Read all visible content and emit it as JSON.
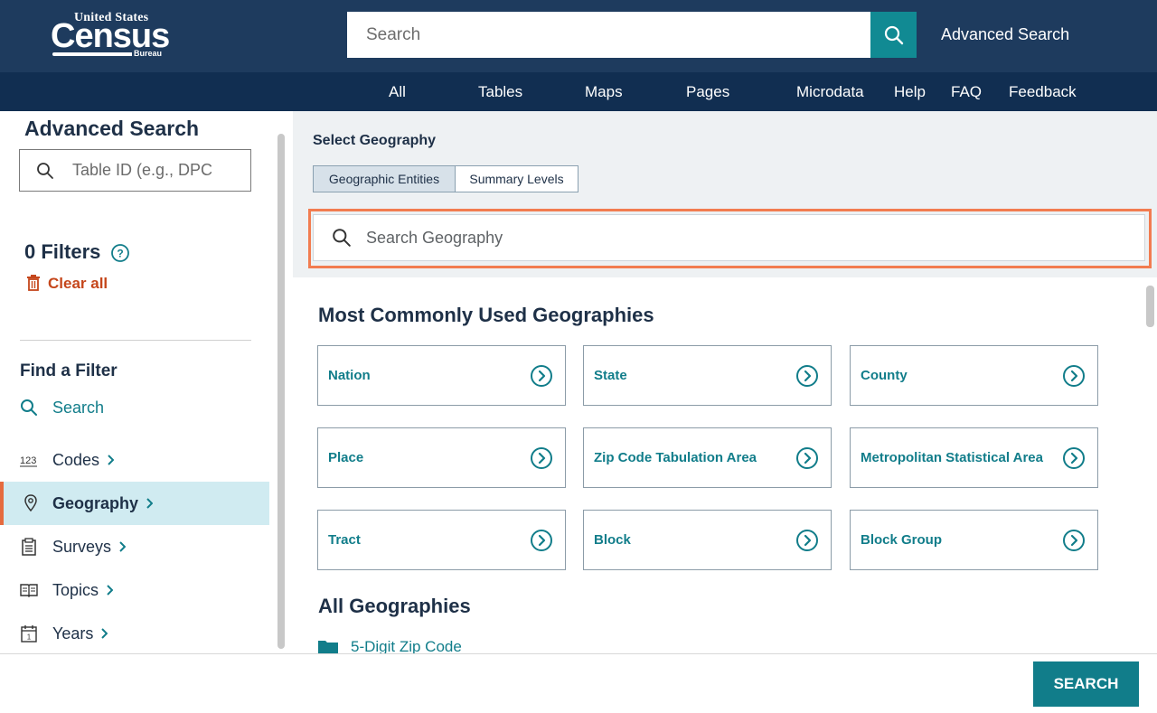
{
  "header": {
    "logo": {
      "line1": "United States",
      "line2": "Census",
      "line3": "Bureau"
    },
    "search_placeholder": "Search",
    "advanced_search": "Advanced Search",
    "nav": [
      "All",
      "Tables",
      "Maps",
      "Pages",
      "Microdata",
      "Help",
      "FAQ",
      "Feedback"
    ]
  },
  "sidebar": {
    "title": "Advanced Search",
    "search_placeholder": "Table ID (e.g., DPC",
    "filters_count": "0 Filters",
    "clear_all": "Clear all",
    "find_filter": "Find a Filter",
    "items": [
      {
        "label": "Search",
        "icon": "search-icon"
      },
      {
        "label": "Codes",
        "icon": "123-icon"
      },
      {
        "label": "Geography",
        "icon": "map-pin-icon",
        "active": true
      },
      {
        "label": "Surveys",
        "icon": "clipboard-icon"
      },
      {
        "label": "Topics",
        "icon": "book-icon"
      },
      {
        "label": "Years",
        "icon": "calendar-icon"
      }
    ]
  },
  "main": {
    "select_geography": "Select Geography",
    "tabs": [
      {
        "label": "Geographic Entities",
        "active": true
      },
      {
        "label": "Summary Levels",
        "active": false
      }
    ],
    "geo_search_placeholder": "Search Geography",
    "common_title": "Most Commonly Used Geographies",
    "common": [
      "Nation",
      "State",
      "County",
      "Place",
      "Zip Code Tabulation Area",
      "Metropolitan Statistical Area",
      "Tract",
      "Block",
      "Block Group"
    ],
    "all_title": "All Geographies",
    "all_first": "5-Digit Zip Code"
  },
  "footer": {
    "search_button": "SEARCH"
  },
  "colors": {
    "header_bg": "#1e3b5e",
    "nav_bg": "#112e51",
    "teal": "#117d8a",
    "orange_highlight": "#f27c50",
    "clear_all": "#c5461b",
    "active_bg": "#d0ebf1"
  }
}
